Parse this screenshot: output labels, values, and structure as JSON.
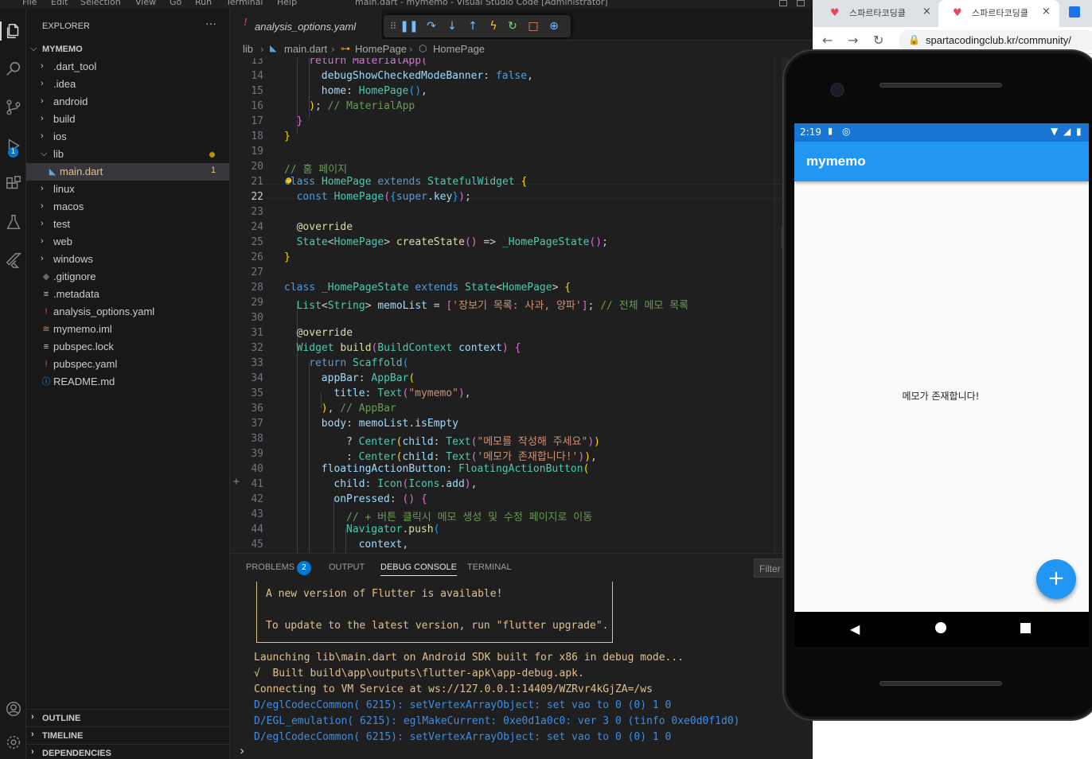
{
  "vscode": {
    "menu": [
      "File",
      "Edit",
      "Selection",
      "View",
      "Go",
      "Run",
      "Terminal",
      "Help"
    ],
    "title": "main.dart - mymemo - Visual Studio Code [Administrator]",
    "explorer": {
      "header": "EXPLORER",
      "more": "···",
      "project": "MYMEMO",
      "items": [
        {
          "label": ".dart_tool",
          "type": "folder"
        },
        {
          "label": ".idea",
          "type": "folder"
        },
        {
          "label": "android",
          "type": "folder"
        },
        {
          "label": "build",
          "type": "folder"
        },
        {
          "label": "ios",
          "type": "folder"
        },
        {
          "label": "lib",
          "type": "folder-open"
        },
        {
          "label": "main.dart",
          "type": "dart",
          "badge": "1"
        },
        {
          "label": "linux",
          "type": "folder"
        },
        {
          "label": "macos",
          "type": "folder"
        },
        {
          "label": "test",
          "type": "folder"
        },
        {
          "label": "web",
          "type": "folder"
        },
        {
          "label": "windows",
          "type": "folder"
        },
        {
          "label": ".gitignore",
          "type": "git"
        },
        {
          "label": ".metadata",
          "type": "lines"
        },
        {
          "label": "analysis_options.yaml",
          "type": "yaml"
        },
        {
          "label": "mymemo.iml",
          "type": "rss"
        },
        {
          "label": "pubspec.lock",
          "type": "lines"
        },
        {
          "label": "pubspec.yaml",
          "type": "yaml"
        },
        {
          "label": "README.md",
          "type": "info"
        }
      ],
      "sections": [
        "OUTLINE",
        "TIMELINE",
        "DEPENDENCIES"
      ]
    },
    "activity_badge": "1",
    "tab": {
      "label": "analysis_options.yaml"
    },
    "breadcrumb": {
      "p1": "lib",
      "p2": "main.dart",
      "p3": "HomePage",
      "p4": "HomePage"
    },
    "line_numbers": [
      "13",
      "14",
      "15",
      "16",
      "17",
      "18",
      "19",
      "20",
      "21",
      "22",
      "23",
      "24",
      "25",
      "26",
      "27",
      "28",
      "29",
      "30",
      "31",
      "32",
      "33",
      "34",
      "35",
      "36",
      "37",
      "38",
      "39",
      "40",
      "41",
      "42",
      "43",
      "44",
      "45"
    ],
    "code": {
      "l13": "return MaterialApp(",
      "l14a": "debugShowCheckedModeBanner",
      "l14b": "false",
      "l15a": "home",
      "l15b": "HomePage",
      "l16": "// MaterialApp",
      "l20": "// 홈 페이지",
      "l21a": "class",
      "l21b": "HomePage",
      "l21c": "extends",
      "l21d": "StatefulWidget",
      "l22a": "const",
      "l22b": "HomePage",
      "l22c": "super",
      "l22d": "key",
      "l24": "@override",
      "l25a": "State",
      "l25b": "HomePage",
      "l25c": "createState",
      "l25d": "_HomePageState",
      "l28a": "class",
      "l28b": "_HomePageState",
      "l28c": "extends",
      "l28d": "State",
      "l28e": "HomePage",
      "l29a": "List",
      "l29b": "String",
      "l29c": "memoList",
      "l29d": "'장보기 목록: 사과, 양파'",
      "l29e": "// 전체 메모 목록",
      "l31": "@override",
      "l32a": "Widget",
      "l32b": "build",
      "l32c": "BuildContext",
      "l32d": "context",
      "l33a": "return",
      "l33b": "Scaffold",
      "l34a": "appBar",
      "l34b": "AppBar",
      "l35a": "title",
      "l35b": "Text",
      "l35c": "\"mymemo\"",
      "l36": "// AppBar",
      "l37a": "body",
      "l37b": "memoList",
      "l37c": "isEmpty",
      "l38a": "Center",
      "l38b": "child",
      "l38c": "Text",
      "l38d": "\"메모를 작성해 주세요\"",
      "l39a": "Center",
      "l39b": "child",
      "l39c": "Text",
      "l39d": "'메모가 존재합니다!'",
      "l40a": "floatingActionButton",
      "l40b": "FloatingActionButton",
      "l41a": "child",
      "l41b": "Icon",
      "l41c": "Icons",
      "l41d": "add",
      "l42a": "onPressed",
      "l43": "// + 버튼 클릭시 메모 생성 및 수정 페이지로 이동",
      "l44a": "Navigator",
      "l44b": "push",
      "l45a": "context"
    },
    "panel": {
      "tabs": [
        "PROBLEMS",
        "OUTPUT",
        "DEBUG CONSOLE",
        "TERMINAL"
      ],
      "problems_count": "2",
      "filter_placeholder": "Filter",
      "console": [
        "A new version of Flutter is available!",
        "To update to the latest version, run \"flutter upgrade\".",
        "Launching lib\\main.dart on Android SDK built for x86 in debug mode...",
        "√  Built build\\app\\outputs\\flutter-apk\\app-debug.apk.",
        "Connecting to VM Service at ws://127.0.0.1:14409/WZRvr4kGjZA=/ws",
        "D/eglCodecCommon( 6215): setVertexArrayObject: set vao to 0 (0) 1 0",
        "D/EGL_emulation( 6215): eglMakeCurrent: 0xe0d1a0c0: ver 3 0 (tinfo 0xe0d0f1d0)",
        "D/eglCodecCommon( 6215): setVertexArrayObject: set vao to 0 (0) 1 0"
      ],
      "prompt": "›"
    }
  },
  "browser": {
    "tabs": [
      {
        "title": "스파르타코딩클"
      },
      {
        "title": "스파르타코딩클"
      }
    ],
    "url": "spartacodingclub.kr/community/"
  },
  "emulator": {
    "time": "2:19",
    "app_title": "mymemo",
    "body_text": "메모가 존재합니다!",
    "fab_icon": "+"
  },
  "colors": {
    "accent": "#2196f3",
    "statusbar": "#1976d2",
    "vscode_blue": "#0078d4"
  }
}
